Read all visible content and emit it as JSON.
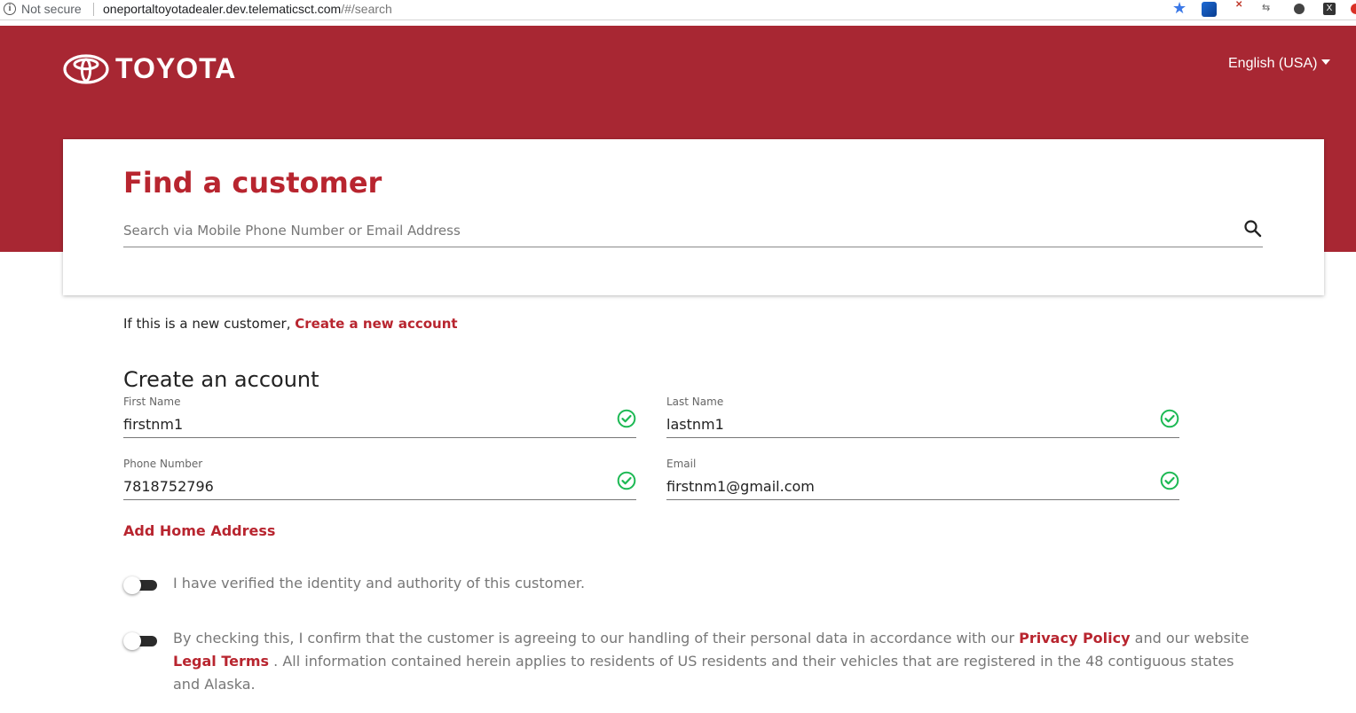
{
  "browser": {
    "not_secure": "Not secure",
    "url_host": "oneportaltoyotadealer.dev.telematicsct.com",
    "url_path": "/#/search"
  },
  "header": {
    "brand": "TOYOTA",
    "language": "English (USA)"
  },
  "search": {
    "title": "Find a customer",
    "placeholder": "Search via Mobile Phone Number or Email Address",
    "value": ""
  },
  "new_customer": {
    "prefix": "If this is a new customer,",
    "link": "Create a new account"
  },
  "create_account": {
    "heading": "Create an account",
    "fields": {
      "first_name": {
        "label": "First Name",
        "value": "firstnm1",
        "valid": true
      },
      "last_name": {
        "label": "Last Name",
        "value": "lastnm1",
        "valid": true
      },
      "phone": {
        "label": "Phone Number",
        "value": "7818752796",
        "valid": true
      },
      "email": {
        "label": "Email",
        "value": "firstnm1@gmail.com",
        "valid": true
      }
    },
    "add_home_address": "Add Home Address"
  },
  "consents": {
    "verify": {
      "text": "I have verified the identity and authority of this customer.",
      "checked": false
    },
    "privacy": {
      "checked": false,
      "text_1": "By checking this, I confirm that the customer is agreeing to our handling of their personal data in accordance with our",
      "privacy_link": "Privacy Policy",
      "text_2": "and our website",
      "legal_link": "Legal Terms",
      "text_3": ". All information contained herein applies to residents of US residents and their vehicles that are registered in the 48 contiguous states and Alaska."
    }
  },
  "colors": {
    "brand_red": "#a82733",
    "accent_red": "#b8252f",
    "valid_green": "#1db954"
  }
}
